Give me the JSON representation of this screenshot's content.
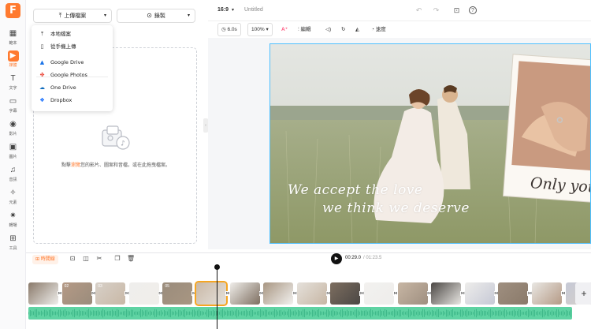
{
  "logo": "F",
  "sidebar": {
    "items": [
      {
        "label": "範本",
        "icon": "template-icon",
        "glyph": "▦"
      },
      {
        "label": "媒體",
        "icon": "media-icon",
        "glyph": "▶",
        "active": true
      },
      {
        "label": "文字",
        "icon": "text-icon",
        "glyph": "T"
      },
      {
        "label": "字幕",
        "icon": "subtitle-icon",
        "glyph": "▭"
      },
      {
        "label": "影片",
        "icon": "video-icon",
        "glyph": "◉"
      },
      {
        "label": "圖片",
        "icon": "image-icon",
        "glyph": "▣"
      },
      {
        "label": "音訊",
        "icon": "audio-icon",
        "glyph": "♫"
      },
      {
        "label": "元素",
        "icon": "elements-icon",
        "glyph": "✧"
      },
      {
        "label": "轉場",
        "icon": "transition-icon",
        "glyph": "✷"
      },
      {
        "label": "工具",
        "icon": "tools-icon",
        "glyph": "⊞"
      }
    ]
  },
  "media": {
    "upload_label": "上傳檔案",
    "record_label": "錄製",
    "upload_menu": [
      {
        "label": "本地檔案",
        "icon": "upload-icon",
        "glyph": "⤒"
      },
      {
        "label": "從手機上傳",
        "icon": "phone-icon",
        "glyph": "▯"
      },
      {
        "label": "Google Drive",
        "icon": "google-drive-icon",
        "glyph": "▲"
      },
      {
        "label": "Google Photos",
        "icon": "google-photos-icon",
        "glyph": "✤"
      },
      {
        "label": "One Drive",
        "icon": "onedrive-icon",
        "glyph": "☁"
      },
      {
        "label": "Dropbox",
        "icon": "dropbox-icon",
        "glyph": "❖"
      }
    ],
    "drop_hint_pre": "點擊",
    "drop_hint_link": "瀏覽",
    "drop_hint_post": "您的影片、圖案和音檔，或在此拖曳檔案。"
  },
  "topbar": {
    "ratio": "16:9",
    "title": "Untitled"
  },
  "toolbar": {
    "duration": "6.0s",
    "zoom": "100%",
    "edit_label": "編輯",
    "speed_label": "速度"
  },
  "canvas": {
    "overlay_line1": "We accept the love",
    "overlay_line2": "we think we deserve",
    "polaroid_caption": "Only you"
  },
  "timeline": {
    "timeline_label": "時間線",
    "current_time": "00:29.0",
    "total_time": "/ 01:23.5",
    "clip_numbers": [
      "",
      "02",
      "03",
      "",
      "05",
      "",
      "",
      "",
      "",
      "",
      "",
      "",
      "",
      "",
      "",
      "",
      ""
    ],
    "add_label": "+"
  },
  "colors": {
    "accent": "#ff7a2f",
    "canvas_border": "#4fc0ff",
    "audio": "#5fd3a3"
  }
}
